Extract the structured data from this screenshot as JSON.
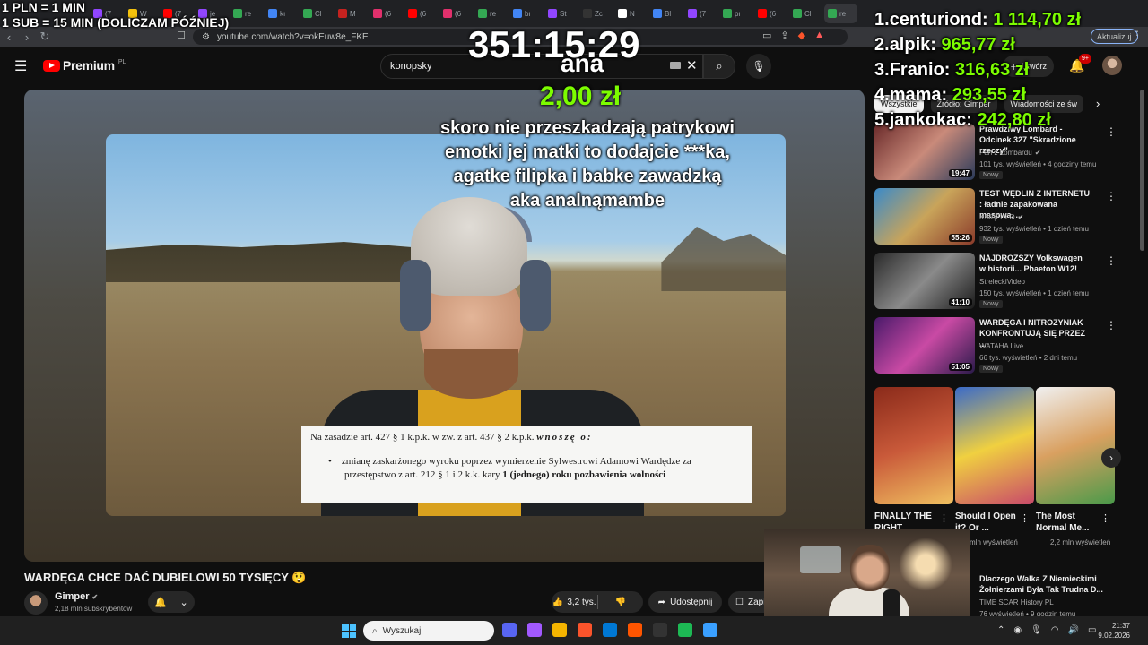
{
  "browser": {
    "tabs": [
      {
        "label": "(7",
        "color": "#9146ff"
      },
      {
        "label": "W",
        "color": "#f4c20d"
      },
      {
        "label": "(7",
        "color": "#ff0000"
      },
      {
        "label": "je",
        "color": "#9146ff"
      },
      {
        "label": "re",
        "color": "#34a853"
      },
      {
        "label": "kı",
        "color": "#4285f4"
      },
      {
        "label": "Cl",
        "color": "#34a853"
      },
      {
        "label": "M",
        "color": "#c5221f"
      },
      {
        "label": "(6",
        "color": "#e1306c"
      },
      {
        "label": "(6",
        "color": "#ff0000"
      },
      {
        "label": "(6",
        "color": "#e1306c"
      },
      {
        "label": "re",
        "color": "#34a853"
      },
      {
        "label": "bı",
        "color": "#4285f4"
      },
      {
        "label": "St",
        "color": "#9146ff"
      },
      {
        "label": "Zc",
        "color": "#333333"
      },
      {
        "label": "N",
        "color": "#ffffff"
      },
      {
        "label": "Bl",
        "color": "#4285f4"
      },
      {
        "label": "(7",
        "color": "#9146ff"
      },
      {
        "label": "pı",
        "color": "#34a853"
      },
      {
        "label": "(6",
        "color": "#ff0000"
      },
      {
        "label": "Cl",
        "color": "#34a853"
      },
      {
        "label": "re",
        "color": "#34a853"
      }
    ],
    "url": "youtube.com/watch?v=okEuw8e_FKE",
    "update_label": "Aktualizuj"
  },
  "youtube": {
    "logo_text": "Premium",
    "logo_country": "PL",
    "search_value": "konopsky",
    "create_label": "Utwórz",
    "notif_count": "9+",
    "video_title": "WARDĘGA CHCE DAĆ DUBIELOWI 50 TYSIĘCY 😲",
    "channel_name": "Gimper",
    "channel_subs": "2,18 mln subskrybentów",
    "likes": "3,2 tys.",
    "share_label": "Udostępnij",
    "save_label": "Zapisz"
  },
  "video_frame": {
    "doc_line1_prefix": "Na zasadzie art. 427 § 1 k.p.k. w zw. z art. 437 § 2 k.p.k.",
    "doc_line1_bold": "wnoszę o:",
    "doc_bullet_text": "zmianę zaskarżonego wyroku poprzez wymierzenie Sylwestrowi Adamowi Wardędze za przestępstwo z art. 212 § 1 i 2 k.k. kary",
    "doc_bullet_bold": "1 (jednego) roku pozbawienia wolności"
  },
  "overlay": {
    "rate_line1": "1 PLN = 1 MIN",
    "rate_line2": "1 SUB = 15 MIN (DOLICZAM PÓŹNIEJ)",
    "timer": "351:15:29",
    "donor": "ana",
    "donation_amount": "2,00 zł",
    "donation_message": "skoro nie przeszkadzają patrykowi emotki jej matki to dodajcie ***ka, agatke filipka i babke zawadzką aka analnąmambe",
    "leaderboard": [
      {
        "rank": "1.",
        "name": "centuriond:",
        "amount": "1 114,70 zł"
      },
      {
        "rank": "2.",
        "name": "alpik:",
        "amount": "965,77 zł"
      },
      {
        "rank": "3.",
        "name": "Franio:",
        "amount": "316,63 zł"
      },
      {
        "rank": "4.",
        "name": "mama:",
        "amount": "293,55 zł"
      },
      {
        "rank": "5.",
        "name": "jankokac:",
        "amount": "242,80 zł"
      }
    ]
  },
  "sidebar": {
    "chips": [
      "Wszystkie",
      "Źródło: Gimper",
      "Wiadomości ze św"
    ],
    "recommendations": [
      {
        "title": "Prawdziwy Lombard - Odcinek 327 \"Skradzione rzeczy\"",
        "channel": "Pan z Lombardu",
        "verified": true,
        "meta": "101 tys. wyświetleń • 4 godziny temu",
        "badge": "Nowy",
        "duration": "19:47",
        "thumb": "linear-gradient(135deg,#6a2a2a,#c98a7a 50%,#2a3a5a)"
      },
      {
        "title": "TEST WĘDLIN Z INTERNETU : ładnie zapakowana masowa, ...",
        "channel": "KSIĄŻULO",
        "verified": true,
        "meta": "932 tys. wyświetleń • 1 dzień temu",
        "badge": "Nowy",
        "duration": "55:26",
        "thumb": "linear-gradient(135deg,#3a8ac9,#c9a45a 50%,#8a3a2a)"
      },
      {
        "title": "NAJDROŻSZY Volkswagen w historii... Phaeton W12!",
        "channel": "StreleckiVideo",
        "verified": false,
        "meta": "150 tys. wyświetleń • 1 dzień temu",
        "badge": "Nowy",
        "duration": "41:10",
        "thumb": "linear-gradient(135deg,#2a2a2a,#8a8a8a 50%,#1a1a1a)"
      },
      {
        "title": "WARDĘGA I NITROZYNIAK KONFRONTUJĄ SIĘ PRZEZ ...",
        "channel": "WATAHA Live",
        "verified": false,
        "meta": "66 tys. wyświetleń • 2 dni temu",
        "badge": "Nowy",
        "duration": "51:05",
        "thumb": "linear-gradient(135deg,#4a1a6a,#c94aa4 50%,#2a1a4a)"
      }
    ],
    "shorts": [
      {
        "title": "FINALLY THE RIGHT",
        "meta": "",
        "thumb": "linear-gradient(160deg,#8a2a1a,#c95a3a 50%,#f0c060)"
      },
      {
        "title": "Should I Open it? Or ...",
        "meta": "mln wyświetleń",
        "thumb": "linear-gradient(160deg,#3a6ac9,#f0d040 50%,#c94a6a)"
      },
      {
        "title": "The Most Normal Me...",
        "meta": "2,2 mln wyświetleń",
        "thumb": "linear-gradient(160deg,#f0f0f0,#d9a060 50%,#4a9a4a)"
      }
    ],
    "bottom_rec": {
      "title": "Dlaczego Walka Z Niemieckimi Żołnierzami Była Tak Trudna D...",
      "channel": "TIME SCAR History PL",
      "meta": "76 wyświetleń • 9 godzin temu"
    }
  },
  "taskbar": {
    "search_placeholder": "Wyszukaj",
    "time": "21:37",
    "date": "9.02.2026",
    "apps": [
      "#5865f2",
      "#a259ff",
      "#f4b400",
      "#fb542b",
      "#0078d4",
      "#ff5500",
      "#333333",
      "#1db954",
      "#3aa0ff"
    ]
  }
}
